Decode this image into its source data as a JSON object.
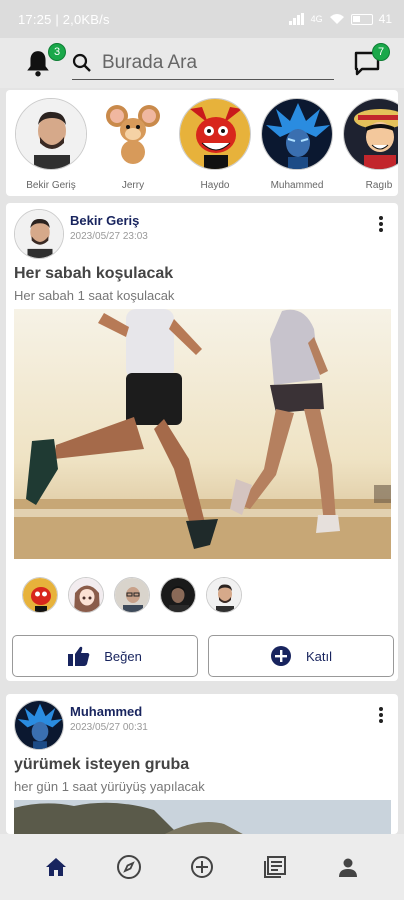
{
  "status_bar": {
    "time_speed": "17:25 | 2,0KB/s",
    "network": "4G",
    "battery": "41"
  },
  "header": {
    "notification_count": "3",
    "search_placeholder": "Burada Ara",
    "message_count": "7"
  },
  "stories": [
    {
      "name": "Bekir Geriş",
      "icon": "avatar-man"
    },
    {
      "name": "Jerry",
      "icon": "avatar-mouse-cartoon"
    },
    {
      "name": "Haydo",
      "icon": "avatar-red-cartoon"
    },
    {
      "name": "Muhammed",
      "icon": "avatar-blue-anime"
    },
    {
      "name": "Ragıb",
      "icon": "avatar-pirate-anime"
    }
  ],
  "posts": [
    {
      "author": "Bekir Geriş",
      "date": "2023/05/27 23:03",
      "title": "Her sabah koşulacak",
      "description": "Her sabah 1 saat koşulacak",
      "image": "photo-two-runners-beach",
      "participants": [
        "red-cartoon",
        "anime-girl",
        "man-with-glasses",
        "man-dark",
        "man"
      ],
      "like_label": "Beğen",
      "join_label": "Katıl"
    },
    {
      "author": "Muhammed",
      "date": "2023/05/27 00:31",
      "title": "yürümek isteyen gruba",
      "description": "her gün 1 saat yürüyüş yapılacak",
      "image": "photo-trees-sky"
    }
  ],
  "bottom_nav": [
    "home-icon",
    "compass-icon",
    "add-circle-icon",
    "feed-icon",
    "profile-icon"
  ],
  "colors": {
    "accent": "#18245e",
    "badge": "#1aa84a",
    "background": "#e4e4e4"
  }
}
